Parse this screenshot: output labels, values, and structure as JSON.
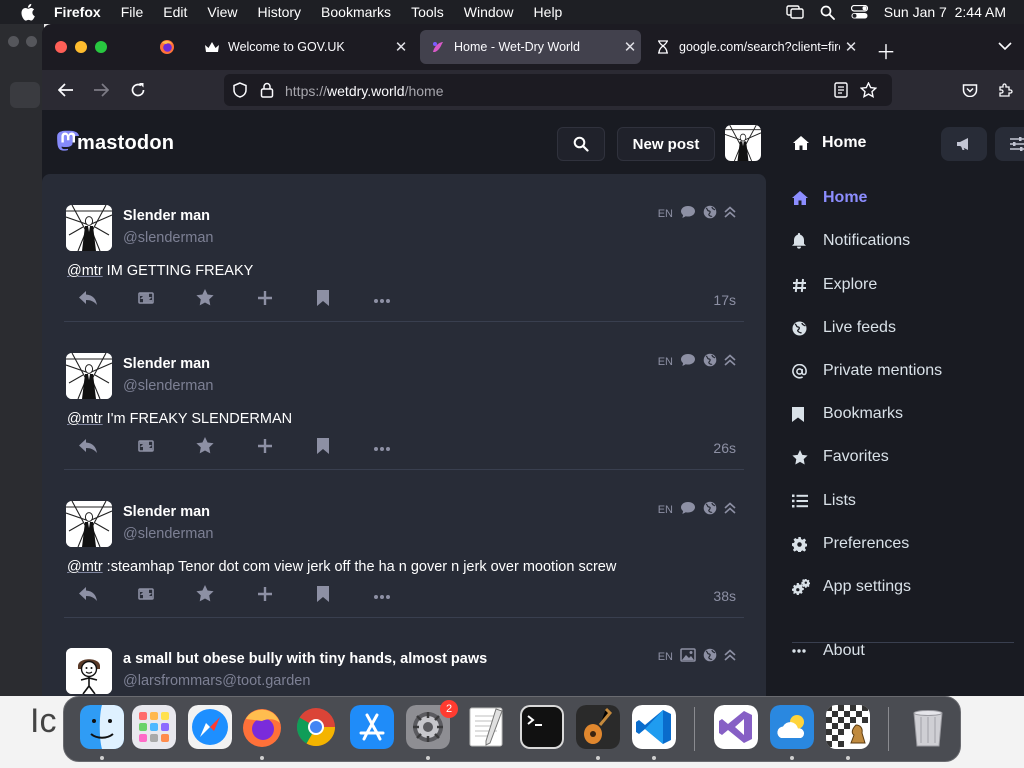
{
  "menubar": {
    "app_name": "Firefox",
    "menus": [
      "File",
      "Edit",
      "View",
      "History",
      "Bookmarks",
      "Tools",
      "Window",
      "Help"
    ],
    "datetime": "Sun Jan 7  2:44 AM"
  },
  "desktop": {
    "partial_text": "Ic"
  },
  "browser": {
    "tabs": [
      {
        "title": "Welcome to GOV.UK",
        "icon": "govuk-crown-icon",
        "active": false
      },
      {
        "title": "Home - Wet-Dry World",
        "icon": "wetdry-favicon-icon",
        "active": true
      },
      {
        "title": "google.com/search?client=firefo",
        "icon": "hourglass-icon",
        "active": false
      }
    ],
    "url": {
      "scheme": "https://",
      "host": "wetdry.world",
      "path": "/home"
    }
  },
  "mastodon": {
    "logo_text": "mastodon",
    "new_post_label": "New post",
    "column_title": "Home",
    "statuses": [
      {
        "display_name": "Slender man",
        "handle": "@slenderman",
        "mention": "@mtr",
        "text": " IM GETTING FREAKY",
        "lang": "EN",
        "time": "17s",
        "media_icon": "comment-icon"
      },
      {
        "display_name": "Slender man",
        "handle": "@slenderman",
        "mention": "@mtr",
        "text": " I'm FREAKY SLENDERMAN",
        "lang": "EN",
        "time": "26s",
        "media_icon": "comment-icon"
      },
      {
        "display_name": "Slender man",
        "handle": "@slenderman",
        "mention": "@mtr",
        "text": " :steamhap Tenor dot com view jerk off the ha n gover n jerk over mootion screw",
        "lang": "EN",
        "time": "38s",
        "media_icon": "comment-icon"
      },
      {
        "display_name": "a small but obese bully with tiny hands, almost paws",
        "handle": "@larsfrommars@toot.garden",
        "mention": "",
        "text": "",
        "lang": "EN",
        "time": "",
        "media_icon": "image-icon"
      }
    ],
    "nav": [
      {
        "label": "Home",
        "icon": "home-icon",
        "active": true
      },
      {
        "label": "Notifications",
        "icon": "bell-icon",
        "active": false
      },
      {
        "label": "Explore",
        "icon": "hashtag-icon",
        "active": false
      },
      {
        "label": "Live feeds",
        "icon": "globe-icon",
        "active": false
      },
      {
        "label": "Private mentions",
        "icon": "at-icon",
        "active": false
      },
      {
        "label": "Bookmarks",
        "icon": "bookmark-icon",
        "active": false
      },
      {
        "label": "Favorites",
        "icon": "star-icon",
        "active": false
      },
      {
        "label": "Lists",
        "icon": "list-icon",
        "active": false
      },
      {
        "label": "Preferences",
        "icon": "gear-icon",
        "active": false
      },
      {
        "label": "App settings",
        "icon": "gears-icon",
        "active": false
      },
      {
        "label": "About",
        "icon": "ellipsis-icon",
        "active": false
      }
    ]
  },
  "dock": {
    "apps": [
      "Finder",
      "Launchpad",
      "Safari",
      "Firefox",
      "Chrome",
      "App Store",
      "System Settings",
      "TextEdit",
      "Terminal",
      "GarageBand",
      "Visual Studio Code",
      "Visual Studio",
      "Weather",
      "Chess",
      "Trash"
    ],
    "system_settings_badge": "2"
  },
  "colors": {
    "accent": "#8c8dff",
    "page_bg": "#191b22",
    "column_bg": "#282c37",
    "muted_text": "#7d8094"
  }
}
